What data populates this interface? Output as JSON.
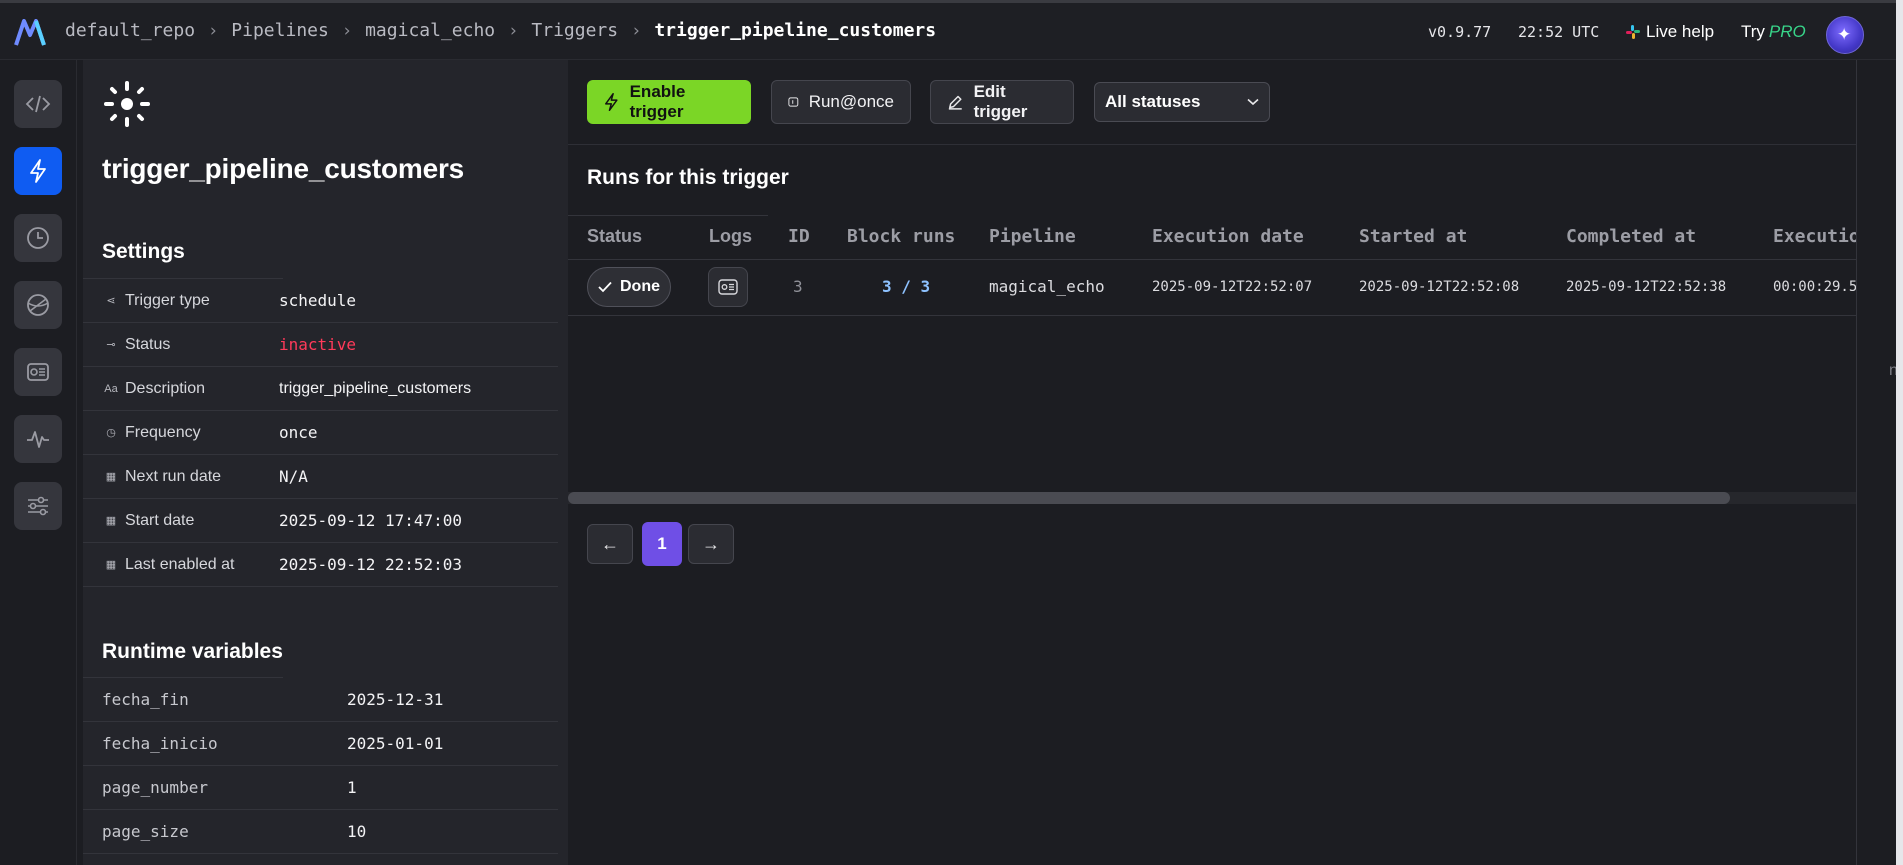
{
  "breadcrumb": [
    "default_repo",
    "Pipelines",
    "magical_echo",
    "Triggers",
    "trigger_pipeline_customers"
  ],
  "header": {
    "version": "v0.9.77",
    "time": "22:52 UTC",
    "live_help": "Live help",
    "try": "Try",
    "pro": "PRO"
  },
  "trigger": {
    "title": "trigger_pipeline_customers"
  },
  "settings": {
    "heading": "Settings",
    "rows": [
      {
        "label": "Trigger type",
        "value": "schedule"
      },
      {
        "label": "Status",
        "value": "inactive"
      },
      {
        "label": "Description",
        "value": "trigger_pipeline_customers"
      },
      {
        "label": "Frequency",
        "value": "once"
      },
      {
        "label": "Next run date",
        "value": "N/A"
      },
      {
        "label": "Start date",
        "value": "2025-09-12 17:47:00"
      },
      {
        "label": "Last enabled at",
        "value": "2025-09-12 22:52:03"
      }
    ],
    "icon_glyphs": [
      "⋖",
      "⊸",
      "Aa",
      "◷",
      "▦",
      "▦",
      "▦"
    ]
  },
  "runtime": {
    "heading": "Runtime variables",
    "vars": [
      {
        "key": "fecha_fin",
        "value": "2025-12-31"
      },
      {
        "key": "fecha_inicio",
        "value": "2025-01-01"
      },
      {
        "key": "page_number",
        "value": "1"
      },
      {
        "key": "page_size",
        "value": "10"
      }
    ]
  },
  "toolbar": {
    "enable": "Enable trigger",
    "run_once": "Run@once",
    "edit": "Edit trigger",
    "status_filter": "All statuses"
  },
  "runs": {
    "title": "Runs for this trigger",
    "columns": [
      "Status",
      "Logs",
      "ID",
      "Block runs",
      "Pipeline",
      "Execution date",
      "Started at",
      "Completed at",
      "Executio"
    ],
    "row": {
      "status": "Done",
      "id": "3",
      "block_runs": "3 / 3",
      "pipeline": "magical_echo",
      "execution_date": "2025-09-12T22:52:07",
      "started_at": "2025-09-12T22:52:08",
      "completed_at": "2025-09-12T22:52:38",
      "execution_time": "00:00:29.5"
    }
  },
  "pagination": {
    "current_page": "1",
    "prev": "←",
    "next": "→"
  },
  "stray_text": "n",
  "colors": {
    "accent_blue": "#0f5cf2",
    "enable_green": "#7bd626",
    "inactive_red": "#ff3a5a",
    "page_purple": "#6f4fe6"
  }
}
